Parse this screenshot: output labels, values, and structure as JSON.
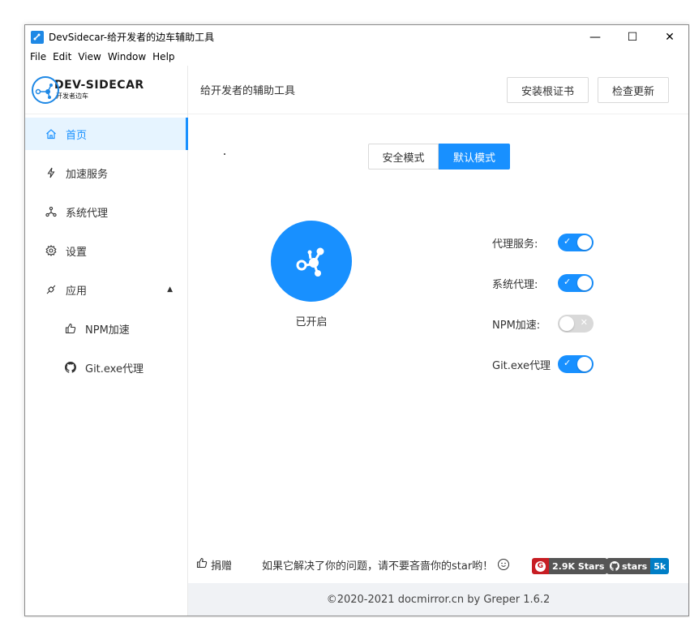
{
  "window": {
    "title": "DevSidecar-给开发者的边车辅助工具",
    "controls": {
      "minimize": "—",
      "maximize": "☐",
      "close": "✕"
    }
  },
  "menu": [
    "File",
    "Edit",
    "View",
    "Window",
    "Help"
  ],
  "logo": {
    "main": "DEV-SIDECAR",
    "sub": "开发者边车"
  },
  "sidebar": {
    "items": [
      {
        "label": "首页",
        "icon": "home-icon"
      },
      {
        "label": "加速服务",
        "icon": "thunderbolt-icon"
      },
      {
        "label": "系统代理",
        "icon": "network-icon"
      },
      {
        "label": "设置",
        "icon": "gear-icon"
      },
      {
        "label": "应用",
        "icon": "api-icon"
      },
      {
        "label": "NPM加速",
        "icon": "like-icon"
      },
      {
        "label": "Git.exe代理",
        "icon": "github-icon"
      }
    ]
  },
  "header": {
    "title": "给开发者的辅助工具",
    "install_cert": "安装根证书",
    "check_update": "检查更新"
  },
  "mode": {
    "safe": "安全模式",
    "default": "默认模式",
    "selected": "默认模式"
  },
  "power": {
    "status": "已开启"
  },
  "switches": [
    {
      "label": "代理服务:",
      "on": true
    },
    {
      "label": "系统代理:",
      "on": true
    },
    {
      "label": "NPM加速:",
      "on": false
    },
    {
      "label": "Git.exe代理",
      "on": true
    }
  ],
  "switch_marks": {
    "on": "✓",
    "off": "✕"
  },
  "footer": {
    "donate": "捐赠",
    "slogan": "如果它解决了你的问题，请不要吝啬你的star哟！",
    "gitee_badge": {
      "count": "2.9K Stars",
      "logo": "G"
    },
    "github_badge": {
      "label": "stars",
      "count": "5k"
    },
    "copyright": "©2020-2021 docmirror.cn by Greper  1.6.2"
  },
  "colors": {
    "primary": "#1890ff",
    "gitee": "#c71d23",
    "github_dark": "#555555",
    "github_count": "#007ec6"
  }
}
